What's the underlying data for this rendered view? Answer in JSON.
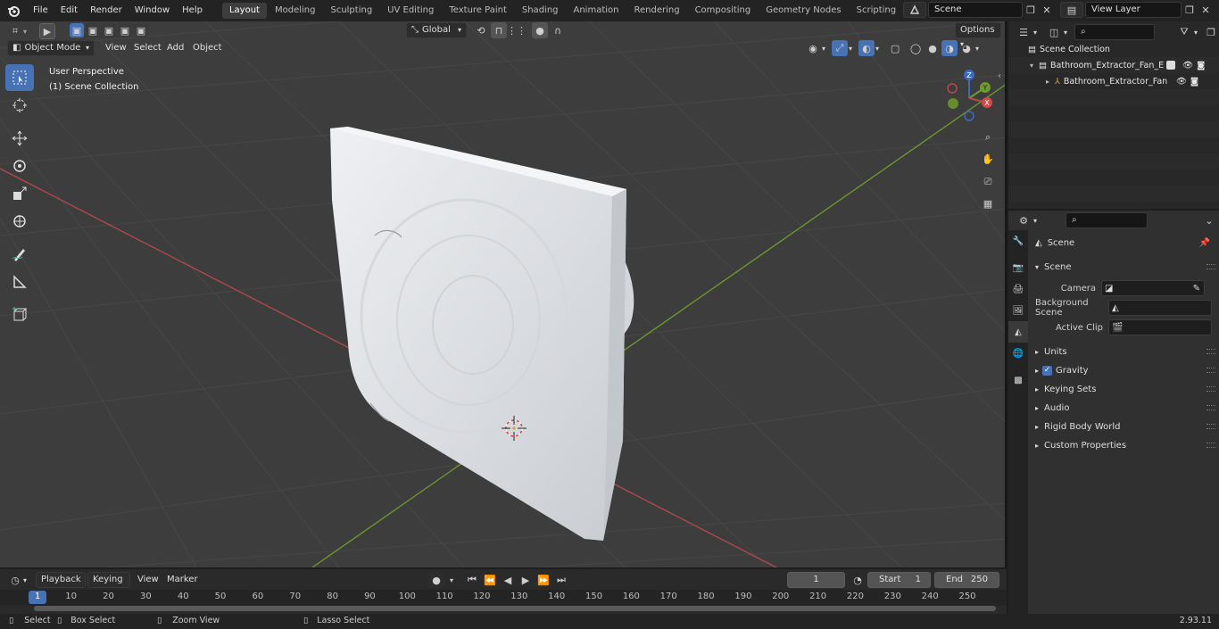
{
  "topbar": {
    "menus": [
      "File",
      "Edit",
      "Render",
      "Window",
      "Help"
    ],
    "workspaces": [
      "Layout",
      "Modeling",
      "Sculpting",
      "UV Editing",
      "Texture Paint",
      "Shading",
      "Animation",
      "Rendering",
      "Compositing",
      "Geometry Nodes",
      "Scripting"
    ],
    "active_workspace": "Layout",
    "scene_name": "Scene",
    "view_layer": "View Layer"
  },
  "viewport_header": {
    "transform_orientation": "Global",
    "options_label": "Options",
    "mode": "Object Mode",
    "menus": [
      "View",
      "Select",
      "Add",
      "Object"
    ]
  },
  "viewport": {
    "perspective_label": "User Perspective",
    "collection_label": "(1) Scene Collection",
    "gizmo": {
      "z": "Z",
      "y": "Y",
      "x": "X"
    }
  },
  "outliner": {
    "search_placeholder": "",
    "rows": [
      {
        "label": "Scene Collection"
      },
      {
        "label": "Bathroom_Extractor_Fan_Env"
      },
      {
        "label": "Bathroom_Extractor_Fan"
      }
    ]
  },
  "properties": {
    "context": "Scene",
    "panel_title": "Scene",
    "fields": [
      {
        "label": "Camera"
      },
      {
        "label": "Background Scene"
      },
      {
        "label": "Active Clip"
      }
    ],
    "sections": [
      "Units",
      "Gravity",
      "Keying Sets",
      "Audio",
      "Rigid Body World",
      "Custom Properties"
    ],
    "gravity_checked": true
  },
  "timeline": {
    "menus": [
      "Playback",
      "Keying",
      "View",
      "Marker"
    ],
    "current_frame": "1",
    "start_label": "Start",
    "start": "1",
    "end_label": "End",
    "end": "250",
    "ticks": [
      "1",
      "10",
      "20",
      "30",
      "40",
      "50",
      "60",
      "70",
      "80",
      "90",
      "100",
      "110",
      "120",
      "130",
      "140",
      "150",
      "160",
      "170",
      "180",
      "190",
      "200",
      "210",
      "220",
      "230",
      "240",
      "250"
    ]
  },
  "statusbar": {
    "select": "Select",
    "box_select": "Box Select",
    "zoom_view": "Zoom View",
    "lasso_select": "Lasso Select",
    "version": "2.93.11"
  },
  "colors": {
    "accent": "#4772b3",
    "x_axis": "#b34a4a",
    "y_axis": "#6f9a2c"
  }
}
